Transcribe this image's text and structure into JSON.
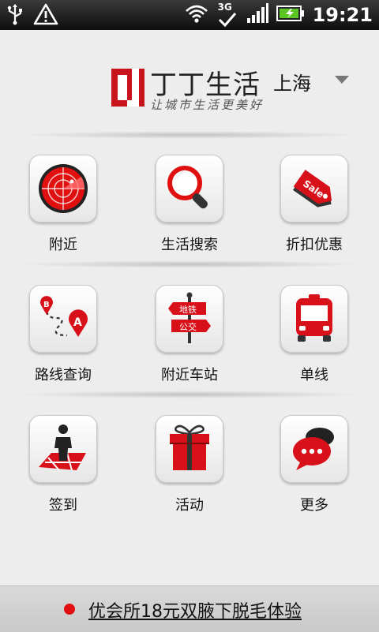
{
  "status_bar": {
    "time": "19:21",
    "network": "3G",
    "icons": [
      "usb-icon",
      "warning-icon",
      "wifi-icon",
      "signal-icon",
      "battery-charging-icon"
    ]
  },
  "header": {
    "logo_text": "丁丁生活",
    "slogan": "让城市生活更美好",
    "city": "上海",
    "brand_color": "#c8141c"
  },
  "grid": [
    {
      "label": "附近",
      "icon": "radar-icon"
    },
    {
      "label": "生活搜索",
      "icon": "magnifier-icon"
    },
    {
      "label": "折扣优惠",
      "icon": "sale-tag-icon"
    },
    {
      "label": "路线查询",
      "icon": "route-icon"
    },
    {
      "label": "附近车站",
      "icon": "signpost-icon"
    },
    {
      "label": "单线",
      "icon": "bus-icon"
    },
    {
      "label": "签到",
      "icon": "checkin-icon"
    },
    {
      "label": "活动",
      "icon": "gift-icon"
    },
    {
      "label": "更多",
      "icon": "chat-bubbles-icon"
    }
  ],
  "signpost": {
    "top": "地铁",
    "bottom": "公交"
  },
  "sale_tag": "Sale",
  "route_markers": {
    "start": "B",
    "end": "A"
  },
  "footer": {
    "text": "优会所18元双腋下脱毛体验",
    "accent": "#e01010"
  }
}
